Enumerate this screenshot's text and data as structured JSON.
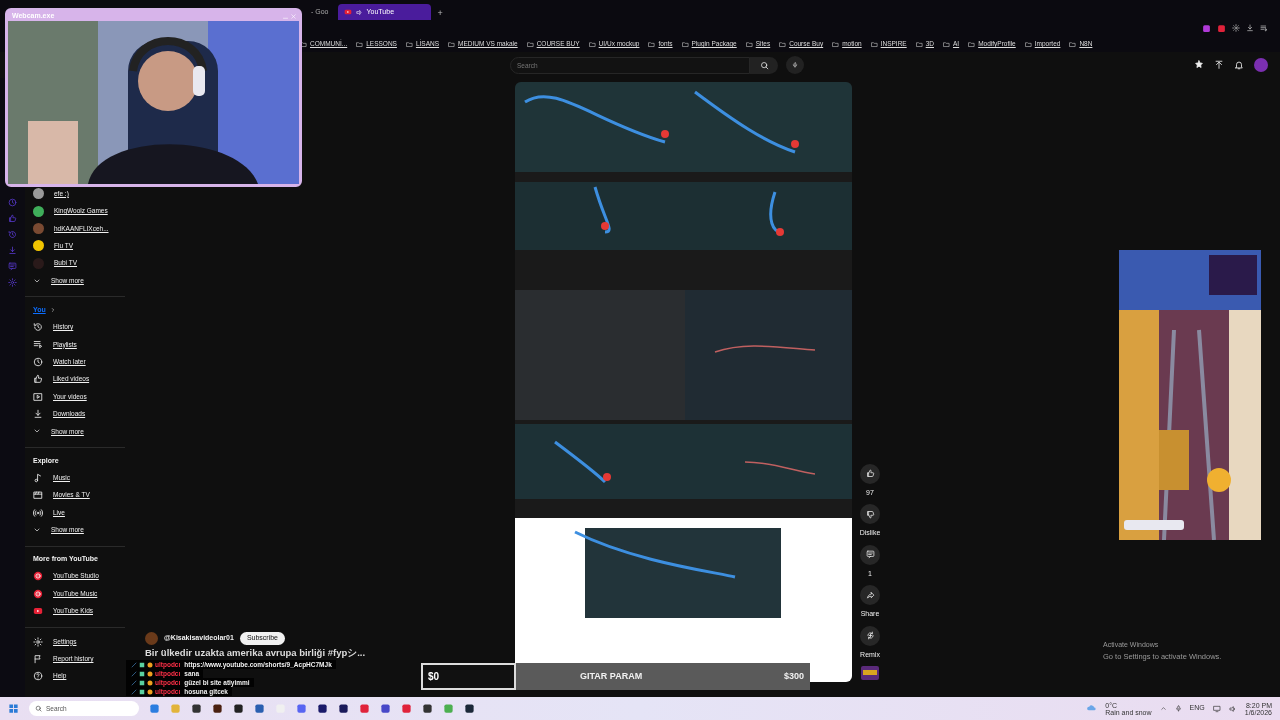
{
  "webcam": {
    "title": "Webcam.exe"
  },
  "browser": {
    "tabs": [
      {
        "label": "- Goo",
        "selected": false
      },
      {
        "label": "YouTube",
        "selected": true
      }
    ],
    "new_tab": "+"
  },
  "bookmarks": [
    "COMMUNİ...",
    "LESSONS",
    "LİSANS",
    "MEDIUM VS makale",
    "COURSE BUY",
    "UI/Ux mockup",
    "fonts",
    "Plugin Package",
    "Sites",
    "Course Buy",
    "motion",
    "INSPIRE",
    "3D",
    "AI",
    "ModifyProfile",
    "Imported",
    "N8N"
  ],
  "header": {
    "search": {
      "placeholder": "Search"
    }
  },
  "sidebar": {
    "subscriptions": [
      {
        "name": "efe :)",
        "color": "#9a9a9a"
      },
      {
        "name": "KingWoolz Games",
        "color": "#3fae5a"
      },
      {
        "name": "hdKAANFLIXceh...",
        "color": "#7a4a32"
      },
      {
        "name": "Flu TV",
        "color": "#f2c500"
      },
      {
        "name": "Bubi TV",
        "color": "#2a1a1a"
      }
    ],
    "subscriptions_more": "Show more",
    "sections": [
      {
        "title": "You",
        "items": [
          {
            "label": "History"
          },
          {
            "label": "Playlists"
          },
          {
            "label": "Watch later"
          },
          {
            "label": "Liked videos"
          },
          {
            "label": "Your videos"
          },
          {
            "label": "Downloads"
          }
        ],
        "more": "Show more"
      },
      {
        "title": "Explore",
        "items": [
          {
            "label": "Music"
          },
          {
            "label": "Movies & TV"
          },
          {
            "label": "Live"
          }
        ],
        "more": "Show more"
      },
      {
        "title": "More from YouTube",
        "items": [
          {
            "label": "YouTube Studio"
          },
          {
            "label": "YouTube Music"
          },
          {
            "label": "YouTube Kids"
          }
        ]
      },
      {
        "items": [
          {
            "label": "Settings"
          },
          {
            "label": "Report history"
          },
          {
            "label": "Help"
          }
        ]
      }
    ]
  },
  "short": {
    "channel": "@Kisakisavideolar01",
    "subscribe": "Subscribe",
    "title": "Bir ülkedir uzakta amerika avrupa birliği #fypシ...",
    "actions": [
      {
        "kind": "like",
        "label": "97"
      },
      {
        "kind": "dislike",
        "label": "Dislike"
      },
      {
        "kind": "comment",
        "label": "1"
      },
      {
        "kind": "share",
        "label": "Share"
      },
      {
        "kind": "remix",
        "label": "Remix"
      }
    ]
  },
  "chat": [
    {
      "user": "ultpodcı",
      "message": "https://www.youtube.com/shorts/9_AcpHC7MJk"
    },
    {
      "user": "ultpodcı",
      "message": "sana"
    },
    {
      "user": "ultpodcı",
      "message": "güzel bi site atiyimmi"
    },
    {
      "user": "ultpodcı",
      "message": "hosuna gitcek"
    }
  ],
  "donation": {
    "current": "$0",
    "label": "GITAR PARAM",
    "goal": "$300",
    "level": 0
  },
  "activation": {
    "title": "Activate Windows",
    "text": "Go to Settings to activate Windows."
  },
  "taskbar": {
    "search": "Search",
    "weather": {
      "temp": "0°C",
      "desc": "Rain and snow"
    },
    "lang": "ENG",
    "time": "8:20 PM",
    "date": "1/6/2026"
  }
}
